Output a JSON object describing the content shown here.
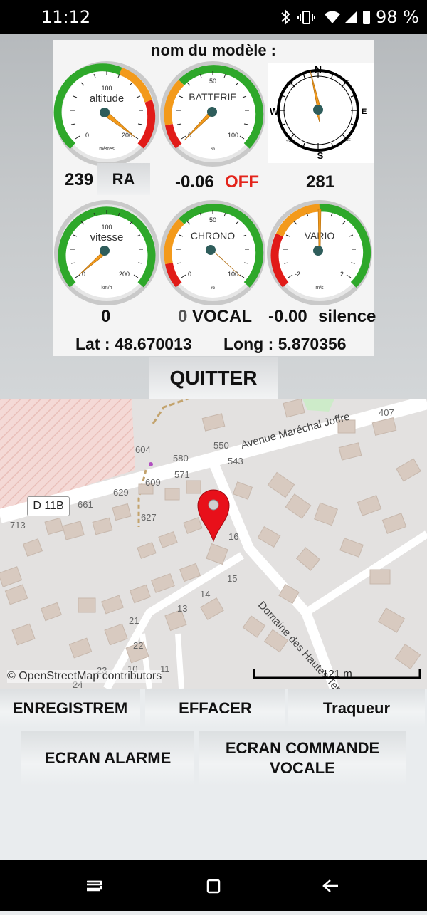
{
  "status": {
    "time": "11:12",
    "battery": "98 %"
  },
  "dashboard": {
    "model_label": "nom du modèle :",
    "gauges": {
      "altitude": {
        "title": "altitude",
        "unit": "mètres",
        "tick_mid": "100",
        "tick_min": "0",
        "tick_max": "200"
      },
      "battery": {
        "title": "BATTERIE",
        "unit": "%",
        "tick_mid": "50",
        "tick_min": "0",
        "tick_max": "100"
      },
      "speed": {
        "title": "vitesse",
        "unit": "km/h",
        "tick_mid": "100",
        "tick_min": "0",
        "tick_max": "200"
      },
      "chrono": {
        "title": "CHRONO",
        "unit": "%",
        "tick_mid": "50",
        "tick_min": "0",
        "tick_max": "100"
      },
      "vario": {
        "title": "VARIO",
        "unit": "m/s",
        "tick_min": "-2",
        "tick_max": "2"
      }
    },
    "compass": {
      "n": "N",
      "s": "S",
      "e": "E",
      "w": "W",
      "ne": "NE",
      "nw": "NW",
      "se": "SE",
      "sw": "SW"
    },
    "altitude_value": "239",
    "ra_label": "RA",
    "battery_value": "-0.06",
    "battery_state": "OFF",
    "heading_value": "281",
    "speed_value": "0",
    "chrono_value": "0",
    "vocal_label": "VOCAL",
    "vario_value": "-0.00",
    "vario_state": "silence",
    "lat": "Lat : 48.670013",
    "long": "Long : 5.870356",
    "quit_label": "QUITTER"
  },
  "map": {
    "attribution": "© OpenStreetMap contributors",
    "scale": "121 m",
    "street_1": "Avenue Maréchal Joffre",
    "street_2": "Domaine des Hautes Terres",
    "road_ref": "D 11B",
    "house_numbers": [
      "407",
      "550",
      "543",
      "604",
      "580",
      "571",
      "609",
      "629",
      "661",
      "627",
      "713",
      "16",
      "15",
      "14",
      "13",
      "21",
      "22",
      "23",
      "24",
      "10",
      "11"
    ]
  },
  "buttons": {
    "record": "ENREGISTREM",
    "erase": "EFFACER",
    "tracker": "Traqueur",
    "alarm_screen": "ECRAN ALARME",
    "voice_screen_1": "ECRAN COMMANDE",
    "voice_screen_2": "VOCALE"
  },
  "colors": {
    "gauge_green": "#2ea82a",
    "gauge_orange": "#f39a1b",
    "gauge_red": "#e11b18",
    "marker_red": "#e8101a",
    "off_red": "#e3241b"
  }
}
